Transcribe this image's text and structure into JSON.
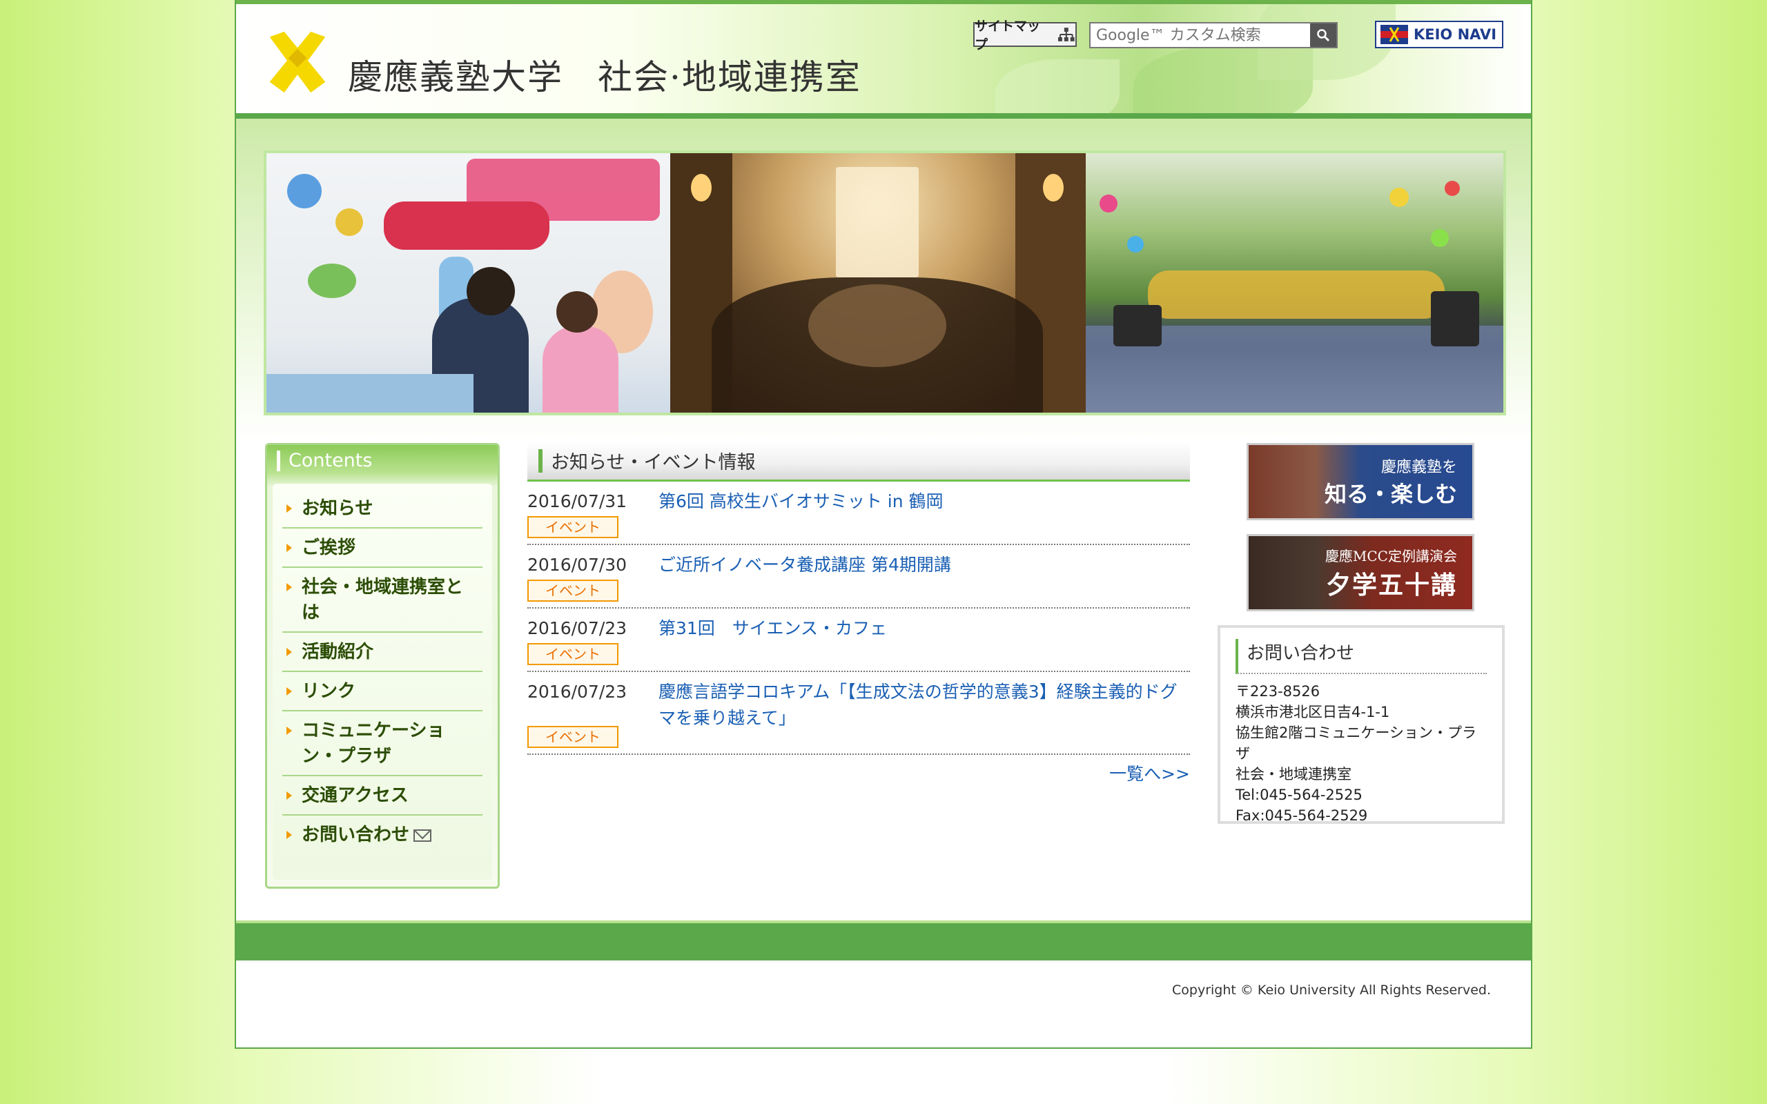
{
  "header": {
    "university": "慶應義塾大学",
    "office": "社会·地域連携室",
    "sitemap_label": "サイトマップ",
    "search_placeholder": "Google™ カスタム検索",
    "keio_navi_label": "KEIO NAVI"
  },
  "sidebar": {
    "title": "Contents",
    "items": [
      {
        "label": "お知らせ"
      },
      {
        "label": "ご挨拶"
      },
      {
        "label": "社会・地域連携室とは"
      },
      {
        "label": "活動紹介"
      },
      {
        "label": "リンク"
      },
      {
        "label": "コミュニケーション・プラザ"
      },
      {
        "label": "交通アクセス"
      },
      {
        "label": "お問い合わせ"
      }
    ]
  },
  "news": {
    "title": "お知らせ・イベント情報",
    "items": [
      {
        "date": "2016/07/31",
        "title": "第6回 高校生バイオサミット in 鶴岡",
        "tag": "イベント"
      },
      {
        "date": "2016/07/30",
        "title": "ご近所イノベータ養成講座 第4期開講",
        "tag": "イベント"
      },
      {
        "date": "2016/07/23",
        "title": "第31回　サイエンス・カフェ",
        "tag": "イベント"
      },
      {
        "date": "2016/07/23",
        "title": "慶應言語学コロキアム「【生成文法の哲学的意義3】経験主義的ドグマを乗り越えて」",
        "tag": "イベント"
      }
    ],
    "more_label": "一覧へ>>"
  },
  "right": {
    "banner_know_line1": "慶應義塾を",
    "banner_know_line2": "知る・楽しむ",
    "banner_mcc_line1": "慶應MCC定例講演会",
    "banner_mcc_line2": "夕学五十講",
    "contact_title": "お問い合わせ",
    "contact_lines": [
      "〒223-8526",
      "横浜市港北区日吉4-1-1",
      "協生館2階コミュニケーション・プラザ",
      "社会・地域連携室",
      "Tel:045-564-2525",
      "Fax:045-564-2529"
    ]
  },
  "footer": {
    "copyright": "Copyright © Keio University All Rights Reserved."
  },
  "colors": {
    "accent_green": "#5aa84a",
    "link_blue": "#1a5fb4",
    "tag_orange": "#f29a00",
    "logo_yellow": "#f5d800"
  }
}
